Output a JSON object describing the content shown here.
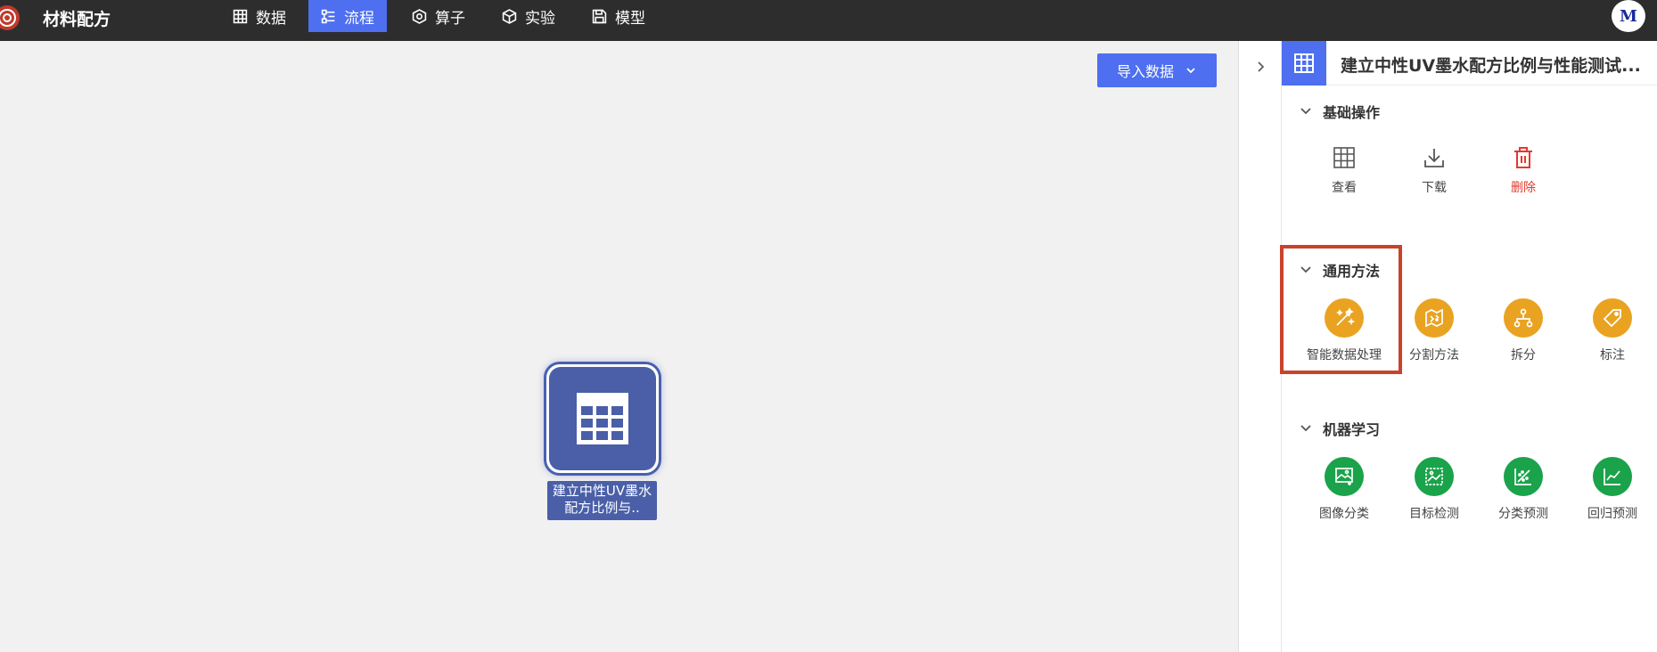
{
  "app": {
    "title": "材料配方",
    "user_initial": "M"
  },
  "nav": [
    {
      "label": "数据",
      "icon": "table-icon",
      "active": false
    },
    {
      "label": "流程",
      "icon": "flow-icon",
      "active": true
    },
    {
      "label": "算子",
      "icon": "operator-icon",
      "active": false
    },
    {
      "label": "实验",
      "icon": "cube-icon",
      "active": false
    },
    {
      "label": "模型",
      "icon": "save-icon",
      "active": false
    }
  ],
  "canvas": {
    "import_button_label": "导入数据",
    "node_label": "建立中性UV墨水配方比例与.."
  },
  "panel": {
    "title": "建立中性UV墨水配方比例与性能测试...",
    "sections": [
      {
        "title": "基础操作",
        "items": [
          {
            "label": "查看",
            "icon": "table-icon"
          },
          {
            "label": "下载",
            "icon": "download-icon"
          },
          {
            "label": "删除",
            "icon": "trash-icon"
          }
        ]
      },
      {
        "title": "通用方法",
        "items": [
          {
            "label": "智能数据处理",
            "icon": "magic-wand-icon"
          },
          {
            "label": "分割方法",
            "icon": "segment-icon"
          },
          {
            "label": "拆分",
            "icon": "split-icon"
          },
          {
            "label": "标注",
            "icon": "tag-icon"
          }
        ]
      },
      {
        "title": "机器学习",
        "items": [
          {
            "label": "图像分类",
            "icon": "image-classify-icon"
          },
          {
            "label": "目标检测",
            "icon": "object-detect-icon"
          },
          {
            "label": "分类预测",
            "icon": "scatter-icon"
          },
          {
            "label": "回归预测",
            "icon": "line-chart-icon"
          }
        ]
      }
    ]
  },
  "colors": {
    "topbar": "#2d2d2d",
    "accent": "#4d6ff0",
    "node": "#4a5fa8",
    "orange": "#e9a321",
    "green": "#1aa34a",
    "delete": "#e03a2f",
    "highlight": "#c9432b"
  }
}
